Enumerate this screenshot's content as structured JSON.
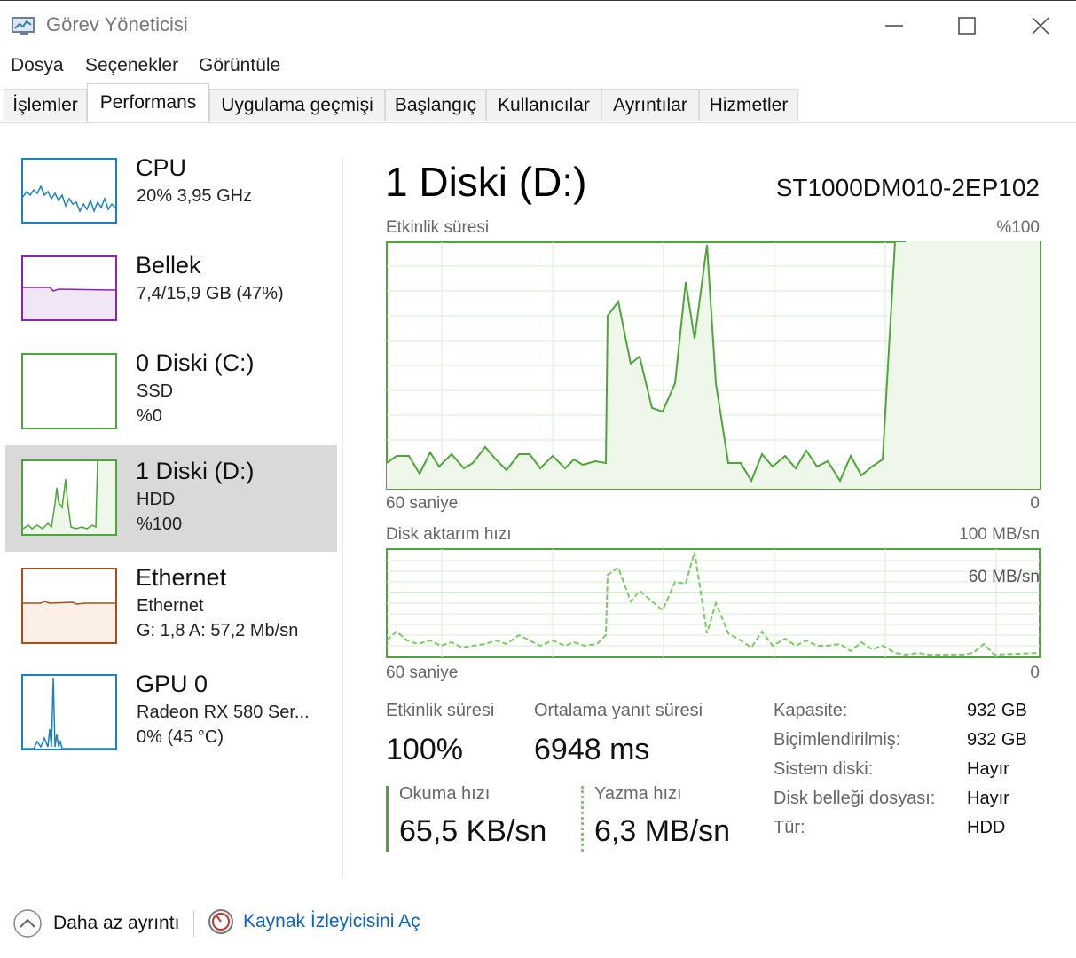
{
  "window": {
    "title": "Görev Yöneticisi"
  },
  "menu": [
    "Dosya",
    "Seçenekler",
    "Görüntüle"
  ],
  "tabs": [
    {
      "label": "İşlemler",
      "active": false
    },
    {
      "label": "Performans",
      "active": true
    },
    {
      "label": "Uygulama geçmişi",
      "active": false
    },
    {
      "label": "Başlangıç",
      "active": false
    },
    {
      "label": "Kullanıcılar",
      "active": false
    },
    {
      "label": "Ayrıntılar",
      "active": false
    },
    {
      "label": "Hizmetler",
      "active": false
    }
  ],
  "sidebar": [
    {
      "title": "CPU",
      "line1": "20% 3,95 GHz",
      "line2": "",
      "color": "#1a82c4",
      "fill": "#ffffff"
    },
    {
      "title": "Bellek",
      "line1": "7,4/15,9 GB (47%)",
      "line2": "",
      "color": "#8b23b8",
      "fill": "#f4ecf7"
    },
    {
      "title": "0 Diski (C:)",
      "line1": "SSD",
      "line2": "%0",
      "color": "#4da638",
      "fill": "#ffffff"
    },
    {
      "title": "1 Diski (D:)",
      "line1": "HDD",
      "line2": "%100",
      "color": "#4da638",
      "fill": "#eef7ea",
      "selected": true
    },
    {
      "title": "Ethernet",
      "line1": "Ethernet",
      "line2": "G: 1,8 A: 57,2 Mb/sn",
      "color": "#a74f1a",
      "fill": "#fcefe5"
    },
    {
      "title": "GPU 0",
      "line1": "Radeon RX 580 Ser...",
      "line2": "0% (45 °C)",
      "color": "#1a82c4",
      "fill": "#ffffff"
    }
  ],
  "main": {
    "title": "1 Diski (D:)",
    "model": "ST1000DM010-2EP102",
    "graph1": {
      "label": "Etkinlik süresi",
      "max": "%100",
      "time": "60 saniye",
      "min": "0"
    },
    "graph2": {
      "label": "Disk aktarım hızı",
      "max": "100 MB/sn",
      "mid": "60 MB/sn",
      "time": "60 saniye",
      "min": "0"
    }
  },
  "stats": {
    "activity_label": "Etkinlik süresi",
    "activity_value": "100%",
    "response_label": "Ortalama yanıt süresi",
    "response_value": "6948 ms",
    "read_label": "Okuma hızı",
    "read_value": "65,5 KB/sn",
    "write_label": "Yazma hızı",
    "write_value": "6,3 MB/sn"
  },
  "properties": [
    {
      "label": "Kapasite:",
      "value": "932 GB"
    },
    {
      "label": "Biçimlendirilmiş:",
      "value": "932 GB"
    },
    {
      "label": "Sistem diski:",
      "value": "Hayır"
    },
    {
      "label": "Disk belleği dosyası:",
      "value": "Hayır"
    },
    {
      "label": "Tür:",
      "value": "HDD"
    }
  ],
  "footer": {
    "less_details": "Daha az ayrıntı",
    "resource_monitor": "Kaynak İzleyicisini Aç"
  },
  "colors": {
    "disk_green": "#4da638",
    "graph_grid": "#d8ecd2"
  },
  "icons": [
    "task-manager-icon",
    "minimize-icon",
    "maximize-icon",
    "close-icon",
    "chevron-up-icon",
    "resource-monitor-icon"
  ]
}
